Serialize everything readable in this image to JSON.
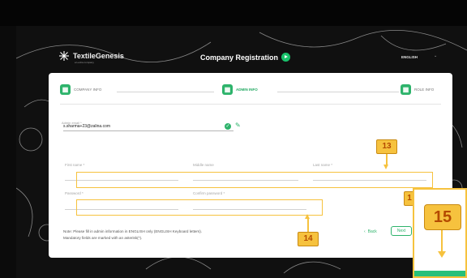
{
  "header": {
    "logo_text": "TextileGenesis",
    "logo_sub": "a Lectra company",
    "title": "Company Registration",
    "language": "ENGLISH",
    "lang_caret": "⌄"
  },
  "steps": [
    {
      "label": "COMPANY INFO",
      "active": false
    },
    {
      "label": "ADMIN INFO",
      "active": true
    },
    {
      "label": "ROLE INFO",
      "active": false
    }
  ],
  "form": {
    "email_caption": "Admin email *",
    "email_value": "s.sharma+23@zalina.com",
    "first_name_label": "First name *",
    "middle_name_label": "Middle name",
    "last_name_label": "Last name *",
    "password_label": "Password *",
    "confirm_password_label": "Confirm password *"
  },
  "note": {
    "line1": "Note: Please fill in admin information in ENGLISH only (ENGLISH Keyboard letters).",
    "line2": "Mandatory fields are marked with an asterisk(*)."
  },
  "actions": {
    "back": "Back",
    "back_icon": "‹",
    "next": "Next"
  },
  "annotations": {
    "badge_13": "13",
    "badge_14": "14",
    "badge_15": "15",
    "badge_15_peek": "1"
  },
  "colors": {
    "brand_green": "#2db36b",
    "highlight_yellow": "#f6c23e",
    "background": "#101010"
  },
  "icons": {
    "step_icon": "building-icon",
    "verified": "check-circle-icon",
    "edit": "pencil-icon"
  }
}
